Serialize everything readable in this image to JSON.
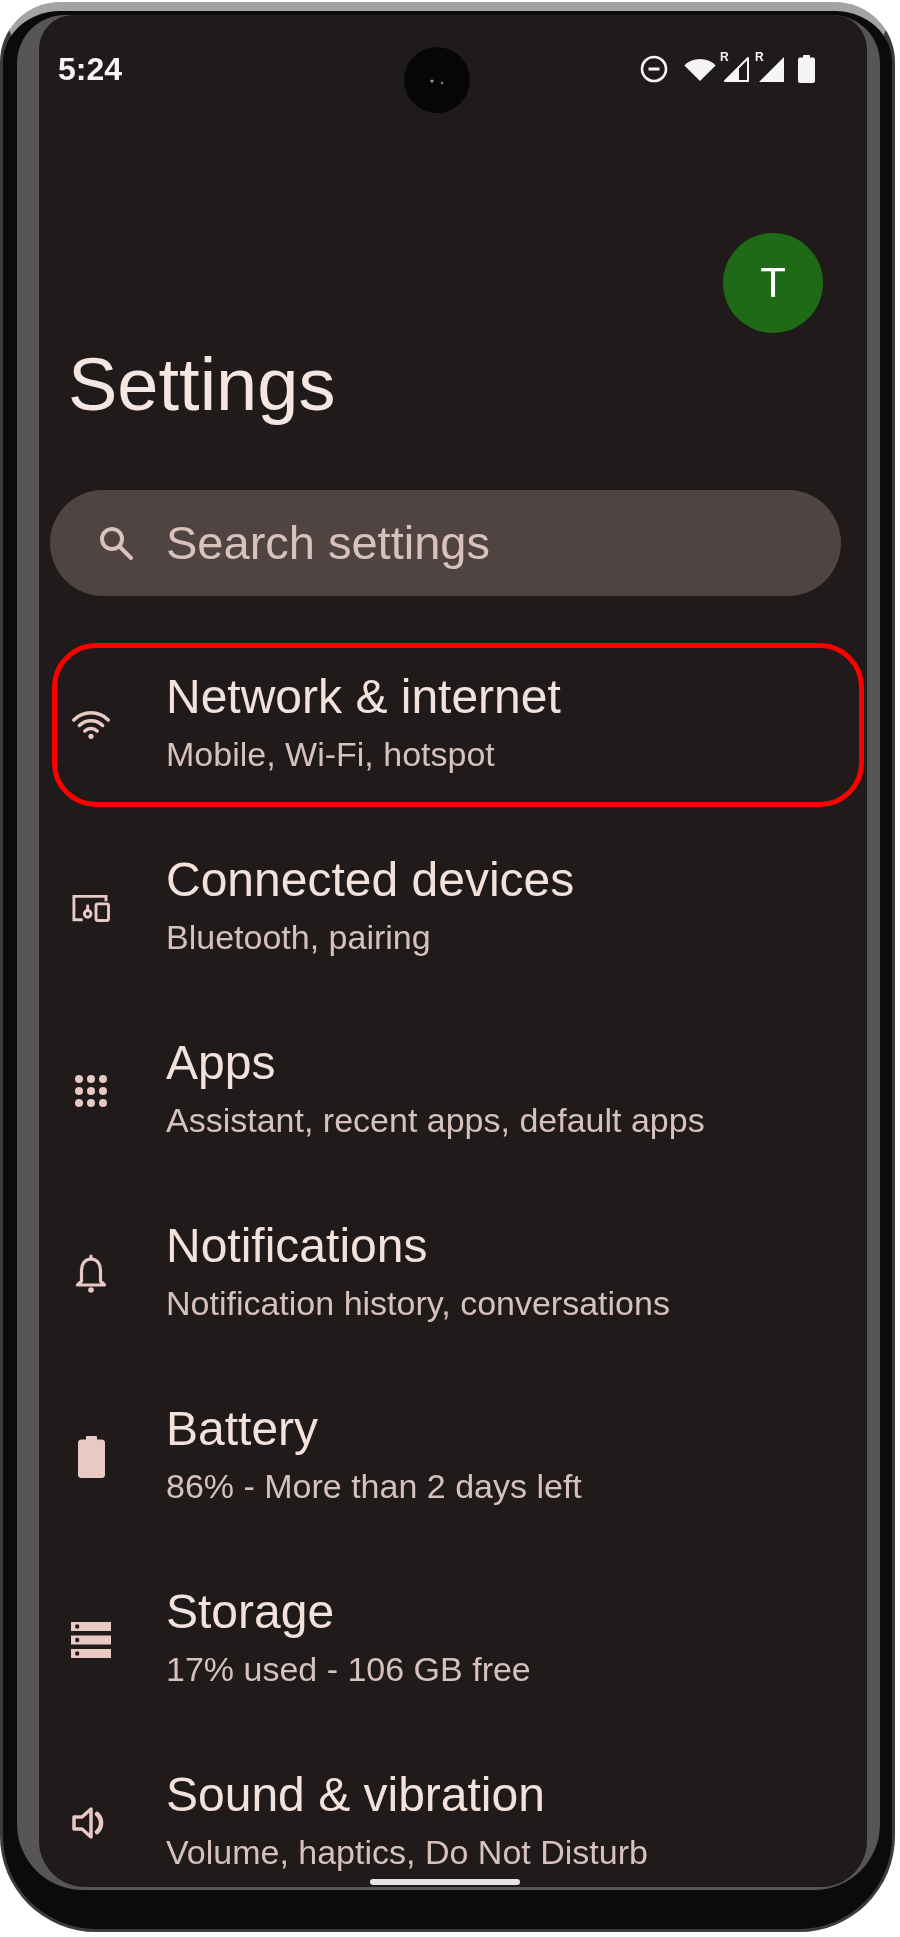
{
  "status_bar": {
    "time": "5:24",
    "signals": [
      {
        "badge": "R"
      },
      {
        "badge": "R"
      }
    ]
  },
  "header": {
    "avatar_letter": "T",
    "title": "Settings"
  },
  "search": {
    "placeholder": "Search settings"
  },
  "items": [
    {
      "title": "Network & internet",
      "subtitle": "Mobile, Wi-Fi, hotspot",
      "highlighted": true
    },
    {
      "title": "Connected devices",
      "subtitle": "Bluetooth, pairing",
      "highlighted": false
    },
    {
      "title": "Apps",
      "subtitle": "Assistant, recent apps, default apps",
      "highlighted": false
    },
    {
      "title": "Notifications",
      "subtitle": "Notification history, conversations",
      "highlighted": false
    },
    {
      "title": "Battery",
      "subtitle": "86% - More than 2 days left",
      "highlighted": false
    },
    {
      "title": "Storage",
      "subtitle": "17% used - 106 GB free",
      "highlighted": false
    },
    {
      "title": "Sound & vibration",
      "subtitle": "Volume, haptics, Do Not Disturb",
      "highlighted": false
    }
  ]
}
